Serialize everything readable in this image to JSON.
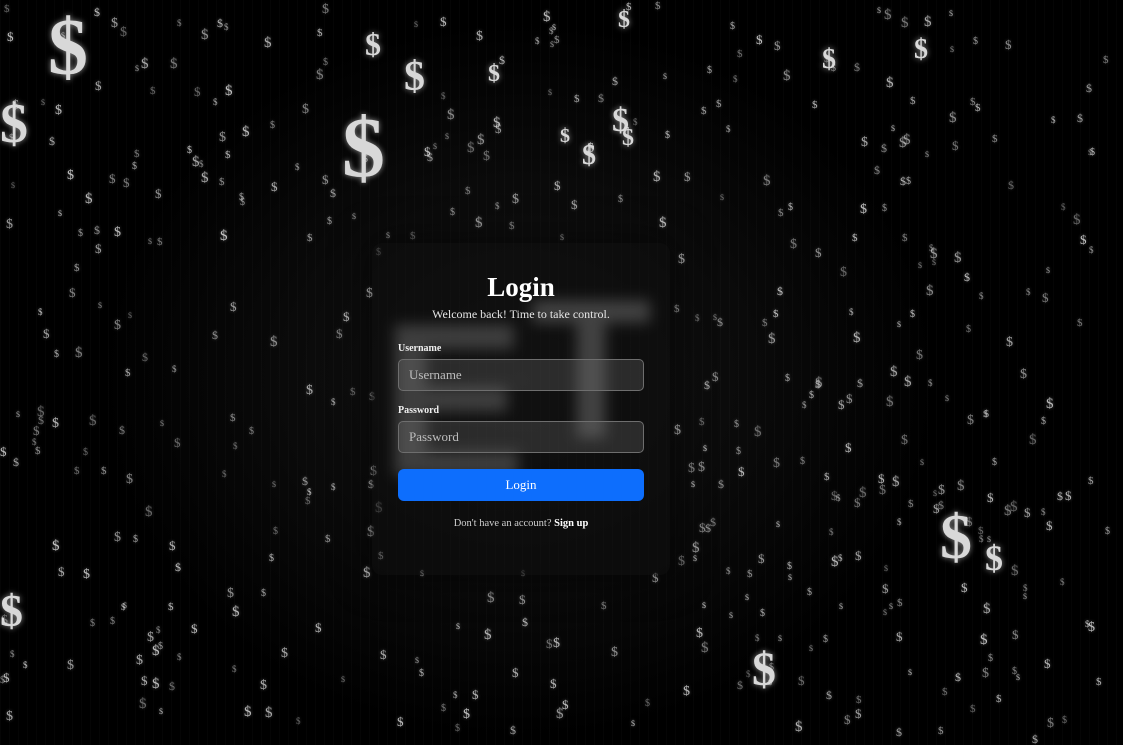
{
  "login": {
    "title": "Login",
    "subtitle": "Welcome back! Time to take control.",
    "username_label": "Username",
    "username_placeholder": "Username",
    "password_label": "Password",
    "password_placeholder": "Password",
    "submit_label": "Login",
    "signup_prompt": "Don't have an account?",
    "signup_link": "Sign up"
  },
  "background": {
    "symbol": "$",
    "symbol_color": "#d8d8d8"
  },
  "colors": {
    "page_background": "#000000",
    "accent": "#0d6efd",
    "text": "#ffffff"
  }
}
